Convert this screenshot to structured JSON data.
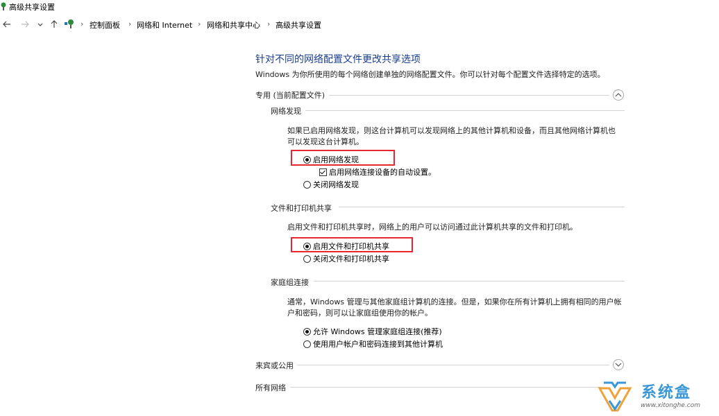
{
  "window": {
    "title": "高级共享设置"
  },
  "nav": {
    "back_icon": "arrow-left-icon",
    "forward_icon": "arrow-right-icon",
    "recent_icon": "chevron-down-icon",
    "up_icon": "arrow-up-icon",
    "breadcrumbs": [
      "控制面板",
      "网络和 Internet",
      "网络和共享中心",
      "高级共享设置"
    ],
    "separator": "›"
  },
  "content": {
    "title": "针对不同的网络配置文件更改共享选项",
    "description": "Windows 为你所使用的每个网络创建单独的网络配置文件。你可以针对每个配置文件选择特定的选项。",
    "profiles": {
      "private": {
        "label": "专用 (当前配置文件)",
        "expanded": true,
        "network_discovery": {
          "header": "网络发现",
          "description_line1": "如果已启用网络发现，则这台计算机可以发现网络上的其他计算机和设备，而且其他网络计算机也",
          "description_line2": "可以发现这台计算机。",
          "option_on": "启用网络发现",
          "auto_setup": "启用网络连接设备的自动设置。",
          "option_off": "关闭网络发现",
          "selected": "on",
          "auto_setup_checked": true
        },
        "file_printer_sharing": {
          "header": "文件和打印机共享",
          "description": "启用文件和打印机共享时，网络上的用户可以访问通过此计算机共享的文件和打印机。",
          "option_on": "启用文件和打印机共享",
          "option_off": "关闭文件和打印机共享",
          "selected": "on"
        },
        "homegroup": {
          "header": "家庭组连接",
          "description_line1": "通常，Windows 管理与其他家庭组计算机的连接。但是，如果你在所有计算机上拥有相同的用户帐",
          "description_line2": "户和密码，则可以让家庭组使用你的帐户。",
          "option_windows": "允许 Windows 管理家庭组连接(推荐)",
          "option_user": "使用用户帐户和密码连接到其他计算机",
          "selected": "windows"
        }
      },
      "guest": {
        "label": "来宾或公用",
        "expanded": false
      },
      "all": {
        "label": "所有网络"
      }
    }
  },
  "watermark": {
    "name": "系统盒",
    "url": "www.xitonghe.com"
  },
  "colors": {
    "title_blue": "#1a3e8c",
    "highlight_red": "#e8262d",
    "watermark_blue": "#3a97d8"
  }
}
